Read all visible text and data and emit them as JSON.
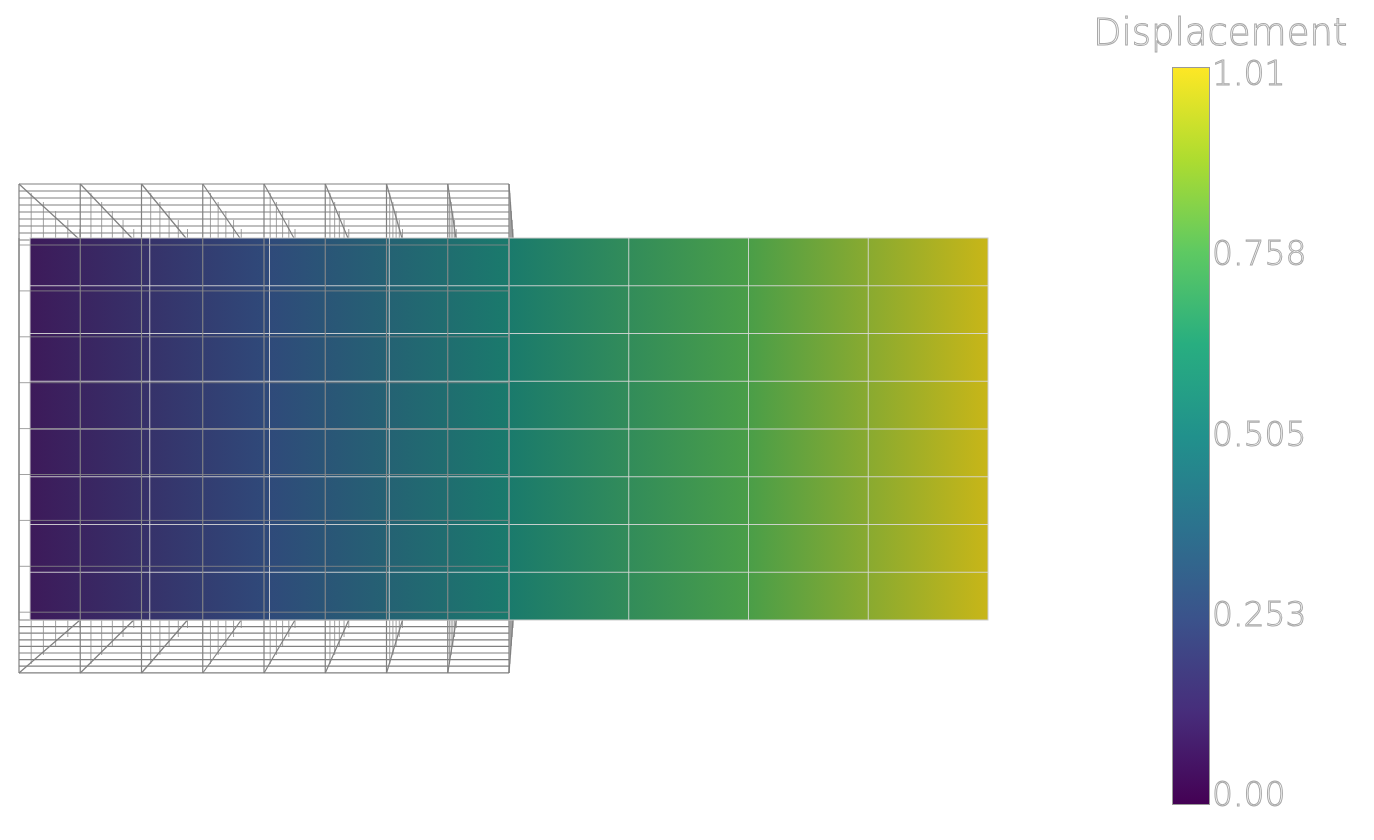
{
  "scene": {
    "kind": "mesh"
  },
  "colorbar": {
    "title": "Displacement",
    "labels": [
      "1.01",
      "0.758",
      "0.505",
      "0.253",
      "0.00"
    ]
  }
}
